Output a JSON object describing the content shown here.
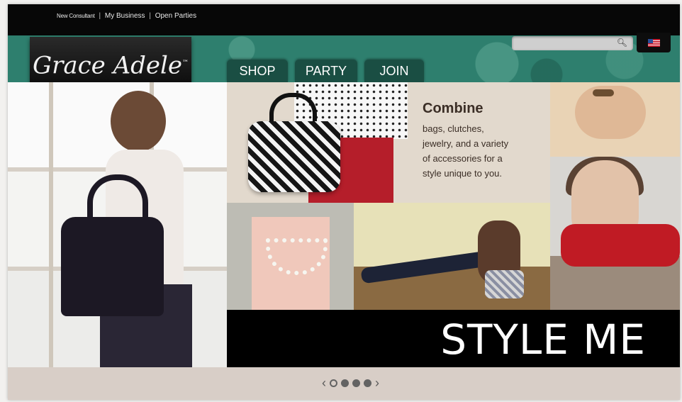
{
  "top_links": {
    "new_consultant": "New Consultant",
    "my_business": "My Business",
    "open_parties": "Open Parties",
    "separator": "|"
  },
  "logo": {
    "text": "Grace Adele",
    "tm": "™"
  },
  "nav": {
    "shop": "SHOP",
    "party": "PARTY",
    "join": "JOIN"
  },
  "search": {
    "icon": "search-icon"
  },
  "flag": "us-flag-icon",
  "promo": {
    "title": "Combine",
    "lines": [
      "bags, clutches,",
      "jewelry, and a variety",
      "of accessories for a",
      "style unique to you."
    ]
  },
  "banner": {
    "text": "STYLE ME"
  },
  "pager": {
    "prev": "‹",
    "next": "›",
    "dots": [
      "empty",
      "filled",
      "filled",
      "filled"
    ]
  },
  "colors": {
    "topbar": "#070707",
    "nav_band": "#2e7f6e",
    "nav_tab": "#1a4e43",
    "banner": "#000000",
    "footer": "#d8cec7"
  }
}
